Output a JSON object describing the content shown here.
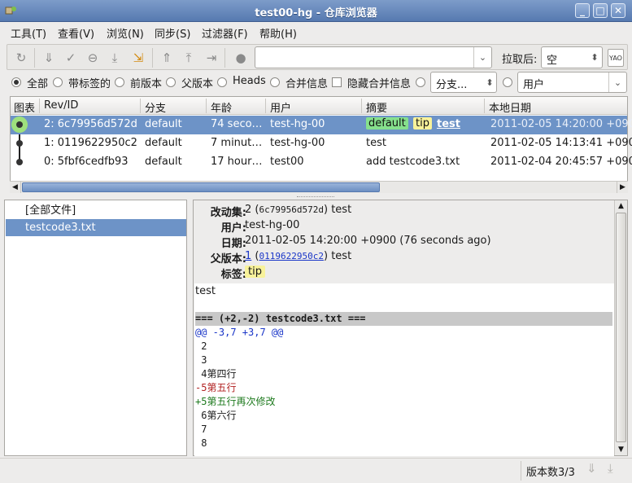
{
  "window": {
    "title": "test00-hg - 仓库浏览器",
    "btn_min": "_",
    "btn_max": "□",
    "btn_close": "✕"
  },
  "menu": [
    "工具(T)",
    "查看(V)",
    "浏览(N)",
    "同步(S)",
    "过滤器(F)",
    "帮助(H)"
  ],
  "toolbar": {
    "pull_label": "拉取后:",
    "pull_value": "空",
    "search_value": ""
  },
  "filter": {
    "opt_all": "全部",
    "opt_tagged": "带标签的",
    "opt_prev": "前版本",
    "opt_parent": "父版本",
    "opt_heads": "Heads",
    "opt_merge": "合并信息",
    "hide_merge": "隐藏合并信息",
    "branch_value": "分支...",
    "user_value": "用户"
  },
  "grid": {
    "columns": [
      "图表",
      "Rev/ID",
      "分支",
      "年龄",
      "用户",
      "摘要",
      "本地日期"
    ],
    "rows": [
      {
        "rev": "2: 6c79956d572d",
        "branch": "default",
        "age": "74 seco…",
        "user": "test-hg-00",
        "tags": [
          "default",
          "tip"
        ],
        "summary": "test",
        "date": "2011-02-05 14:20:00 +090"
      },
      {
        "rev": "1: 0119622950c2",
        "branch": "default",
        "age": "7 minut…",
        "user": "test-hg-00",
        "tags": [],
        "summary": "test",
        "date": "2011-02-05 14:13:41 +090"
      },
      {
        "rev": "0: 5fbf6cedfb93",
        "branch": "default",
        "age": "17 hour…",
        "user": "test00",
        "tags": [],
        "summary": "add testcode3.txt",
        "date": "2011-02-04 20:45:57 +090"
      }
    ]
  },
  "files": {
    "all_files": "[全部文件]",
    "items": [
      "testcode3.txt"
    ]
  },
  "details": {
    "changeset_key": "改动集:",
    "changeset_rev": "2",
    "changeset_hash": "6c79956d572d",
    "changeset_msg": "test",
    "user_key": "用户:",
    "user_val": "test-hg-00",
    "date_key": "日期:",
    "date_val": "2011-02-05 14:20:00 +0900 (76 seconds ago)",
    "parent_key": "父版本:",
    "parent_rev": "1",
    "parent_hash": "0119622950c2",
    "parent_msg": "test",
    "tags_key": "标签:",
    "tags_val": "tip"
  },
  "diff": {
    "message": "test",
    "file_header": "=== (+2,-2) testcode3.txt ===",
    "hunk": "@@ -3,7 +3,7 @@",
    "lines": [
      {
        "type": "ctx",
        "text": " 2"
      },
      {
        "type": "ctx",
        "text": " 3"
      },
      {
        "type": "ctx",
        "text": " 4第四行"
      },
      {
        "type": "del",
        "text": "-5第五行"
      },
      {
        "type": "add",
        "text": "+5第五行再次修改"
      },
      {
        "type": "ctx",
        "text": " 6第六行"
      },
      {
        "type": "ctx",
        "text": " 7"
      },
      {
        "type": "ctx",
        "text": " 8"
      }
    ]
  },
  "status": {
    "revcount": "版本数3/3"
  },
  "colors": {
    "selection": "#6d93c7",
    "branch_tag": "#86e08c",
    "tip_tag": "#f8f29a",
    "del": "#b22222",
    "add": "#1e7a1e",
    "hunk": "#1a36c8"
  }
}
